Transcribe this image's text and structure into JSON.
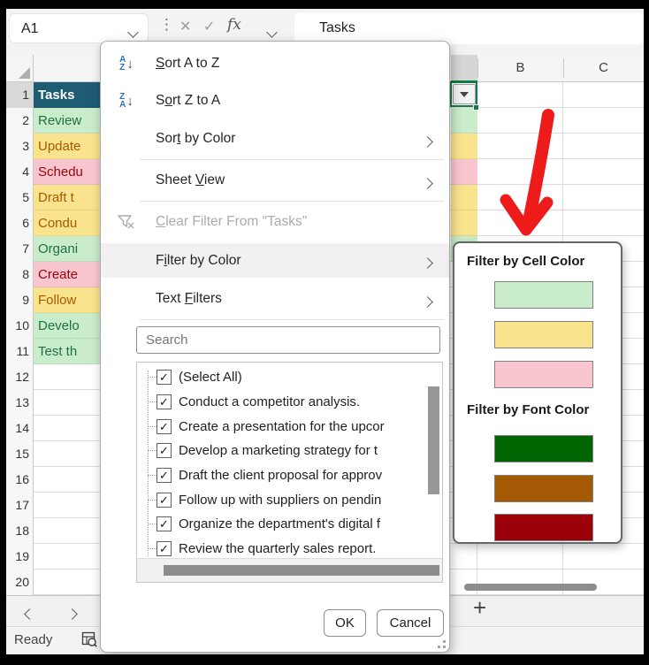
{
  "app": {
    "name_box": "A1",
    "formula_value": "Tasks",
    "fx_label": "fx",
    "ready_label": "Ready",
    "add_sheet_label": "+"
  },
  "icons": {
    "close": "✕",
    "check": "✓",
    "dots": "⋮",
    "down_arrow": "↓",
    "sort_az": {
      "top": "A",
      "bottom": "Z"
    },
    "sort_za": {
      "top": "Z",
      "bottom": "A"
    }
  },
  "grid": {
    "col_headers": [
      "B",
      "C"
    ],
    "row_numbers": [
      "1",
      "2",
      "3",
      "4",
      "5",
      "6",
      "7",
      "8",
      "9",
      "10",
      "11",
      "12",
      "13",
      "14",
      "15",
      "16",
      "17",
      "18",
      "19",
      "20"
    ],
    "a_col": {
      "header": "Tasks",
      "tasks": [
        "Review",
        "Update",
        "Schedu",
        "Draft t",
        "Condu",
        "Organi",
        "Create",
        "Follow",
        "Develo",
        "Test th"
      ]
    }
  },
  "palette": {
    "header_cell_bg": "#1E5C74",
    "header_cell_text": "#FFFFFF",
    "cell_green": "#C9ECCB",
    "cell_yellow": "#FAE38D",
    "cell_pink": "#F9C6D0",
    "font_green": "#1E7145",
    "font_orange": "#A45A04",
    "font_red": "#9C0109",
    "swatch_dark_green": "#006400",
    "swatch_dark_orange": "#A45A04",
    "swatch_dark_red": "#9C0109",
    "selection_green": "#107C41",
    "arrow_red": "#ED1C1A"
  },
  "menu": {
    "items": [
      {
        "pre": "",
        "key": "S",
        "post": "ort A to Z"
      },
      {
        "pre": "S",
        "key": "o",
        "post": "rt Z to A"
      },
      {
        "pre": "Sor",
        "key": "t",
        "post": " by Color"
      },
      {
        "pre": "Sheet ",
        "key": "V",
        "post": "iew"
      },
      {
        "pre": "",
        "key": "C",
        "post": "lear Filter From \"Tasks\""
      },
      {
        "pre": "F",
        "key": "i",
        "post": "lter by Color"
      },
      {
        "pre": "Text ",
        "key": "F",
        "post": "ilters"
      }
    ],
    "search_placeholder": "Search",
    "list_items": [
      "(Select All)",
      "Conduct a competitor analysis.",
      "Create a presentation for the upcor",
      "Develop a marketing strategy for t",
      "Draft the client proposal for approv",
      "Follow up with suppliers on pendin",
      "Organize the department's digital f",
      "Review the quarterly sales report."
    ],
    "ok_label": "OK",
    "cancel_label": "Cancel"
  },
  "submenu": {
    "cell_color_title": "Filter by Cell Color",
    "font_color_title": "Filter by Font Color"
  }
}
